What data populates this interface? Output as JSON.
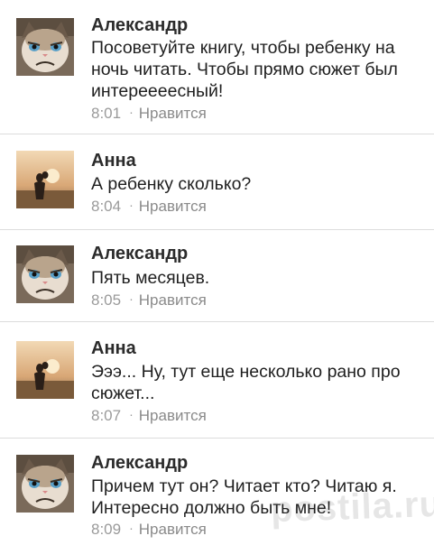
{
  "comments": [
    {
      "author": "Александр",
      "avatar": "grumpy-cat-avatar",
      "text": "Посоветуйте книгу, чтобы ребенку на ночь читать. Чтобы прямо сюжет был интереееесный!",
      "time": "8:01",
      "like_label": "Нравится"
    },
    {
      "author": "Анна",
      "avatar": "couple-sunset-avatar",
      "text": "А ребенку сколько?",
      "time": "8:04",
      "like_label": "Нравится"
    },
    {
      "author": "Александр",
      "avatar": "grumpy-cat-avatar",
      "text": "Пять месяцев.",
      "time": "8:05",
      "like_label": "Нравится"
    },
    {
      "author": "Анна",
      "avatar": "couple-sunset-avatar",
      "text": "Эээ... Ну, тут еще несколько рано про сюжет...",
      "time": "8:07",
      "like_label": "Нравится"
    },
    {
      "author": "Александр",
      "avatar": "grumpy-cat-avatar",
      "text": "Причем тут он? Читает кто? Читаю я. Интересно должно быть мне!",
      "time": "8:09",
      "like_label": "Нравится"
    }
  ],
  "separator": "·",
  "watermark": "postila.ru"
}
